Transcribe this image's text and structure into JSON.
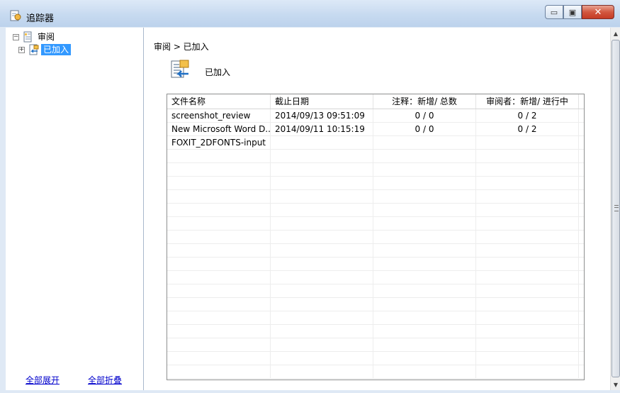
{
  "window": {
    "title": "追踪器",
    "minimize_symbol": "▭",
    "maximize_symbol": "▣",
    "close_symbol": "✕"
  },
  "tree": {
    "root": {
      "label": "审阅",
      "expander": "−",
      "icon": "review-icon"
    },
    "child": {
      "label": "已加入",
      "expander": "+",
      "icon": "joined-icon",
      "selected": true
    }
  },
  "left_links": {
    "expand_all": "全部展开",
    "collapse_all": "全部折叠"
  },
  "breadcrumb": "审阅 > 已加入",
  "header": {
    "title": "已加入",
    "icon": "joined-document-icon"
  },
  "table": {
    "columns": [
      "文件名称",
      "截止日期",
      "注释：新增/ 总数",
      "审阅者：新增/ 进行中"
    ],
    "rows": [
      [
        "screenshot_review",
        "2014/09/13 09:51:09",
        "0 / 0",
        "0 / 2"
      ],
      [
        "New Microsoft Word D...",
        "2014/09/11 10:15:19",
        "0 / 0",
        "0 / 2"
      ],
      [
        "FOXIT_2DFONTS-input",
        "",
        "",
        ""
      ]
    ],
    "empty_rows": 17
  },
  "colors": {
    "selection": "#3399ff",
    "link": "#0000cc",
    "title_bar": "#c7daf0",
    "close_button": "#c53b24"
  }
}
